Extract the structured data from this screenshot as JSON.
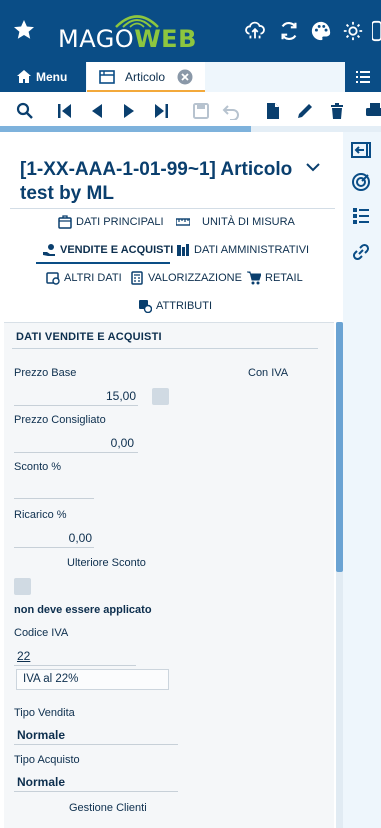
{
  "brand": {
    "logo_part1": "MAGO",
    "logo_part2": "WEB"
  },
  "tabs": {
    "menu_label": "Menu",
    "article_label": "Articolo"
  },
  "toolbar": {
    "progress_fraction": 0.66
  },
  "record": {
    "title": "[1-XX-AAA-1-01-99~1] Articolo test by ML"
  },
  "nav": [
    {
      "label": "DATI PRINCIPALI",
      "icon": "folder-icon"
    },
    {
      "label": "UNITÀ DI MISURA",
      "icon": "ruler-icon"
    },
    {
      "label": "VENDITE E ACQUISTI",
      "icon": "hand-coins-icon",
      "active": true
    },
    {
      "label": "DATI AMMINISTRATIVI",
      "icon": "building-icon"
    },
    {
      "label": "ALTRI DATI",
      "icon": "folder-gear-icon"
    },
    {
      "label": "VALORIZZAZIONE",
      "icon": "calculator-icon"
    },
    {
      "label": "RETAIL",
      "icon": "cart-icon"
    },
    {
      "label": "ATTRIBUTI",
      "icon": "attributes-icon"
    }
  ],
  "form": {
    "section_title": "DATI VENDITE E ACQUISTI",
    "prezzo_base_label": "Prezzo Base",
    "prezzo_base_value": "15,00",
    "con_iva_label": "Con IVA",
    "prezzo_consigliato_label": "Prezzo Consigliato",
    "prezzo_consigliato_value": "0,00",
    "sconto_label": "Sconto %",
    "sconto_value": "",
    "ricarico_label": "Ricarico %",
    "ricarico_value": "0,00",
    "ulteriore_sconto_label": "Ulteriore Sconto",
    "non_applicato_label": "non deve essere applicato",
    "codice_iva_label": "Codice IVA",
    "codice_iva_value": "22",
    "codice_iva_desc": "IVA al 22%",
    "tipo_vendita_label": "Tipo Vendita",
    "tipo_vendita_value": "Normale",
    "tipo_acquisto_label": "Tipo Acquisto",
    "tipo_acquisto_value": "Normale",
    "gestione_clienti_label": "Gestione Clienti"
  },
  "colors": {
    "primary": "#0a4d86",
    "accent": "#8dc63f",
    "tab_underline": "#f3a93b"
  }
}
